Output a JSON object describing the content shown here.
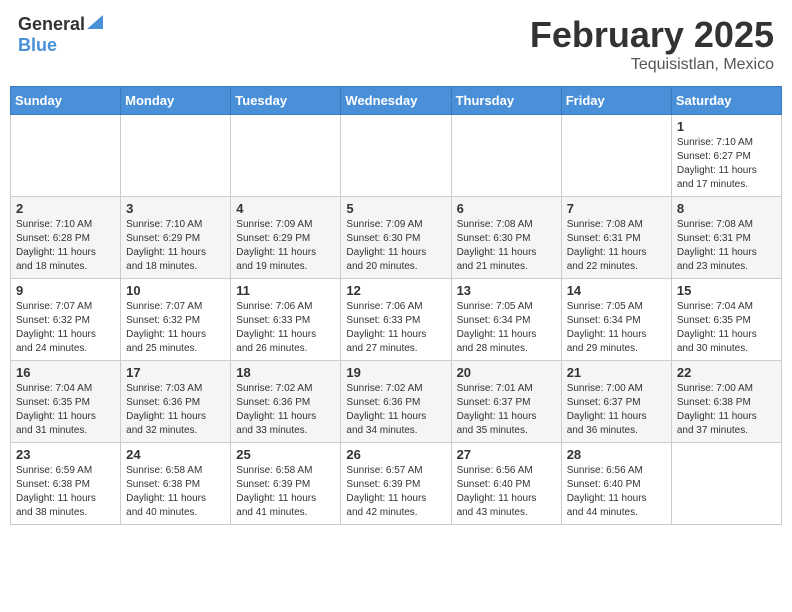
{
  "header": {
    "logo_general": "General",
    "logo_blue": "Blue",
    "month_year": "February 2025",
    "location": "Tequisistlan, Mexico"
  },
  "days_of_week": [
    "Sunday",
    "Monday",
    "Tuesday",
    "Wednesday",
    "Thursday",
    "Friday",
    "Saturday"
  ],
  "weeks": [
    [
      {
        "day": "",
        "info": ""
      },
      {
        "day": "",
        "info": ""
      },
      {
        "day": "",
        "info": ""
      },
      {
        "day": "",
        "info": ""
      },
      {
        "day": "",
        "info": ""
      },
      {
        "day": "",
        "info": ""
      },
      {
        "day": "1",
        "info": "Sunrise: 7:10 AM\nSunset: 6:27 PM\nDaylight: 11 hours\nand 17 minutes."
      }
    ],
    [
      {
        "day": "2",
        "info": "Sunrise: 7:10 AM\nSunset: 6:28 PM\nDaylight: 11 hours\nand 18 minutes."
      },
      {
        "day": "3",
        "info": "Sunrise: 7:10 AM\nSunset: 6:29 PM\nDaylight: 11 hours\nand 18 minutes."
      },
      {
        "day": "4",
        "info": "Sunrise: 7:09 AM\nSunset: 6:29 PM\nDaylight: 11 hours\nand 19 minutes."
      },
      {
        "day": "5",
        "info": "Sunrise: 7:09 AM\nSunset: 6:30 PM\nDaylight: 11 hours\nand 20 minutes."
      },
      {
        "day": "6",
        "info": "Sunrise: 7:08 AM\nSunset: 6:30 PM\nDaylight: 11 hours\nand 21 minutes."
      },
      {
        "day": "7",
        "info": "Sunrise: 7:08 AM\nSunset: 6:31 PM\nDaylight: 11 hours\nand 22 minutes."
      },
      {
        "day": "8",
        "info": "Sunrise: 7:08 AM\nSunset: 6:31 PM\nDaylight: 11 hours\nand 23 minutes."
      }
    ],
    [
      {
        "day": "9",
        "info": "Sunrise: 7:07 AM\nSunset: 6:32 PM\nDaylight: 11 hours\nand 24 minutes."
      },
      {
        "day": "10",
        "info": "Sunrise: 7:07 AM\nSunset: 6:32 PM\nDaylight: 11 hours\nand 25 minutes."
      },
      {
        "day": "11",
        "info": "Sunrise: 7:06 AM\nSunset: 6:33 PM\nDaylight: 11 hours\nand 26 minutes."
      },
      {
        "day": "12",
        "info": "Sunrise: 7:06 AM\nSunset: 6:33 PM\nDaylight: 11 hours\nand 27 minutes."
      },
      {
        "day": "13",
        "info": "Sunrise: 7:05 AM\nSunset: 6:34 PM\nDaylight: 11 hours\nand 28 minutes."
      },
      {
        "day": "14",
        "info": "Sunrise: 7:05 AM\nSunset: 6:34 PM\nDaylight: 11 hours\nand 29 minutes."
      },
      {
        "day": "15",
        "info": "Sunrise: 7:04 AM\nSunset: 6:35 PM\nDaylight: 11 hours\nand 30 minutes."
      }
    ],
    [
      {
        "day": "16",
        "info": "Sunrise: 7:04 AM\nSunset: 6:35 PM\nDaylight: 11 hours\nand 31 minutes."
      },
      {
        "day": "17",
        "info": "Sunrise: 7:03 AM\nSunset: 6:36 PM\nDaylight: 11 hours\nand 32 minutes."
      },
      {
        "day": "18",
        "info": "Sunrise: 7:02 AM\nSunset: 6:36 PM\nDaylight: 11 hours\nand 33 minutes."
      },
      {
        "day": "19",
        "info": "Sunrise: 7:02 AM\nSunset: 6:36 PM\nDaylight: 11 hours\nand 34 minutes."
      },
      {
        "day": "20",
        "info": "Sunrise: 7:01 AM\nSunset: 6:37 PM\nDaylight: 11 hours\nand 35 minutes."
      },
      {
        "day": "21",
        "info": "Sunrise: 7:00 AM\nSunset: 6:37 PM\nDaylight: 11 hours\nand 36 minutes."
      },
      {
        "day": "22",
        "info": "Sunrise: 7:00 AM\nSunset: 6:38 PM\nDaylight: 11 hours\nand 37 minutes."
      }
    ],
    [
      {
        "day": "23",
        "info": "Sunrise: 6:59 AM\nSunset: 6:38 PM\nDaylight: 11 hours\nand 38 minutes."
      },
      {
        "day": "24",
        "info": "Sunrise: 6:58 AM\nSunset: 6:38 PM\nDaylight: 11 hours\nand 40 minutes."
      },
      {
        "day": "25",
        "info": "Sunrise: 6:58 AM\nSunset: 6:39 PM\nDaylight: 11 hours\nand 41 minutes."
      },
      {
        "day": "26",
        "info": "Sunrise: 6:57 AM\nSunset: 6:39 PM\nDaylight: 11 hours\nand 42 minutes."
      },
      {
        "day": "27",
        "info": "Sunrise: 6:56 AM\nSunset: 6:40 PM\nDaylight: 11 hours\nand 43 minutes."
      },
      {
        "day": "28",
        "info": "Sunrise: 6:56 AM\nSunset: 6:40 PM\nDaylight: 11 hours\nand 44 minutes."
      },
      {
        "day": "",
        "info": ""
      }
    ]
  ]
}
